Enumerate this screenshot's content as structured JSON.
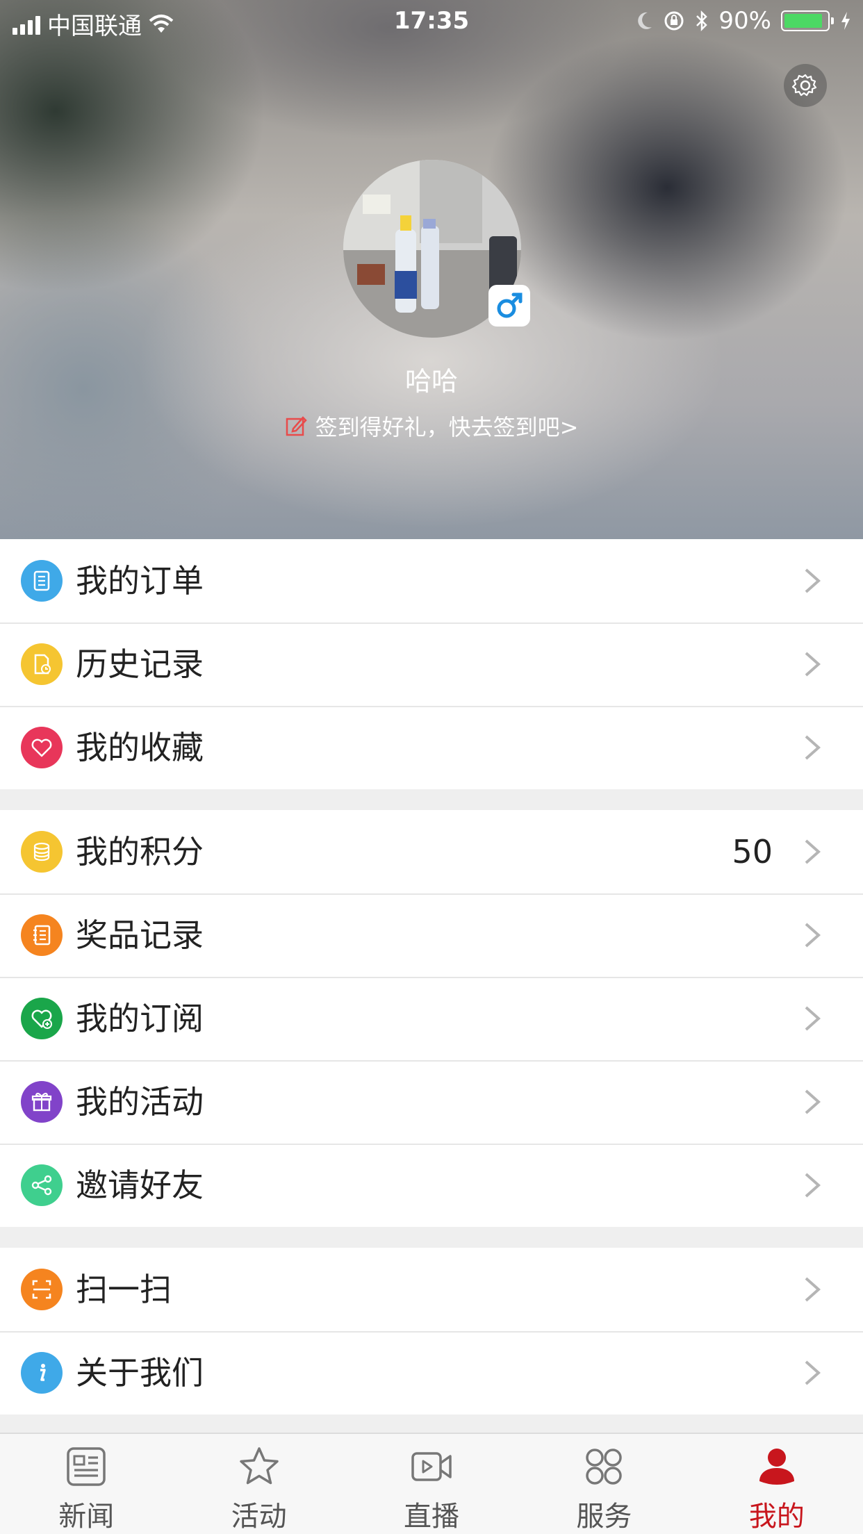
{
  "status_bar": {
    "carrier": "中国联通",
    "time": "17:35",
    "battery_percent": "90%",
    "battery_level": 0.9
  },
  "profile": {
    "nickname": "哈哈",
    "signin_text": "签到得好礼，快去签到吧>",
    "gender_icon": "male-icon"
  },
  "menu_groups": [
    [
      {
        "label": "我的订单",
        "icon": "order-icon",
        "color": "#3fa9e8"
      },
      {
        "label": "历史记录",
        "icon": "history-icon",
        "color": "#f5c531"
      },
      {
        "label": "我的收藏",
        "icon": "heart-icon",
        "color": "#e8365a"
      }
    ],
    [
      {
        "label": "我的积分",
        "icon": "coins-icon",
        "color": "#f5c531",
        "value": "50"
      },
      {
        "label": "奖品记录",
        "icon": "prize-record-icon",
        "color": "#f5841f"
      },
      {
        "label": "我的订阅",
        "icon": "subscribe-icon",
        "color": "#1aa64a"
      },
      {
        "label": "我的活动",
        "icon": "gift-icon",
        "color": "#8143c9"
      },
      {
        "label": "邀请好友",
        "icon": "share-icon",
        "color": "#3fcf8e"
      }
    ],
    [
      {
        "label": "扫一扫",
        "icon": "scan-icon",
        "color": "#f5841f"
      },
      {
        "label": "关于我们",
        "icon": "info-icon",
        "color": "#3fa9e8"
      }
    ]
  ],
  "tabs": [
    {
      "label": "新闻",
      "icon": "news-icon"
    },
    {
      "label": "活动",
      "icon": "star-icon"
    },
    {
      "label": "直播",
      "icon": "video-icon"
    },
    {
      "label": "服务",
      "icon": "services-icon"
    },
    {
      "label": "我的",
      "icon": "person-icon",
      "active": true
    }
  ],
  "colors": {
    "accent": "#c8161d",
    "chevron": "#b5b5b5",
    "separator": "#efefef"
  }
}
